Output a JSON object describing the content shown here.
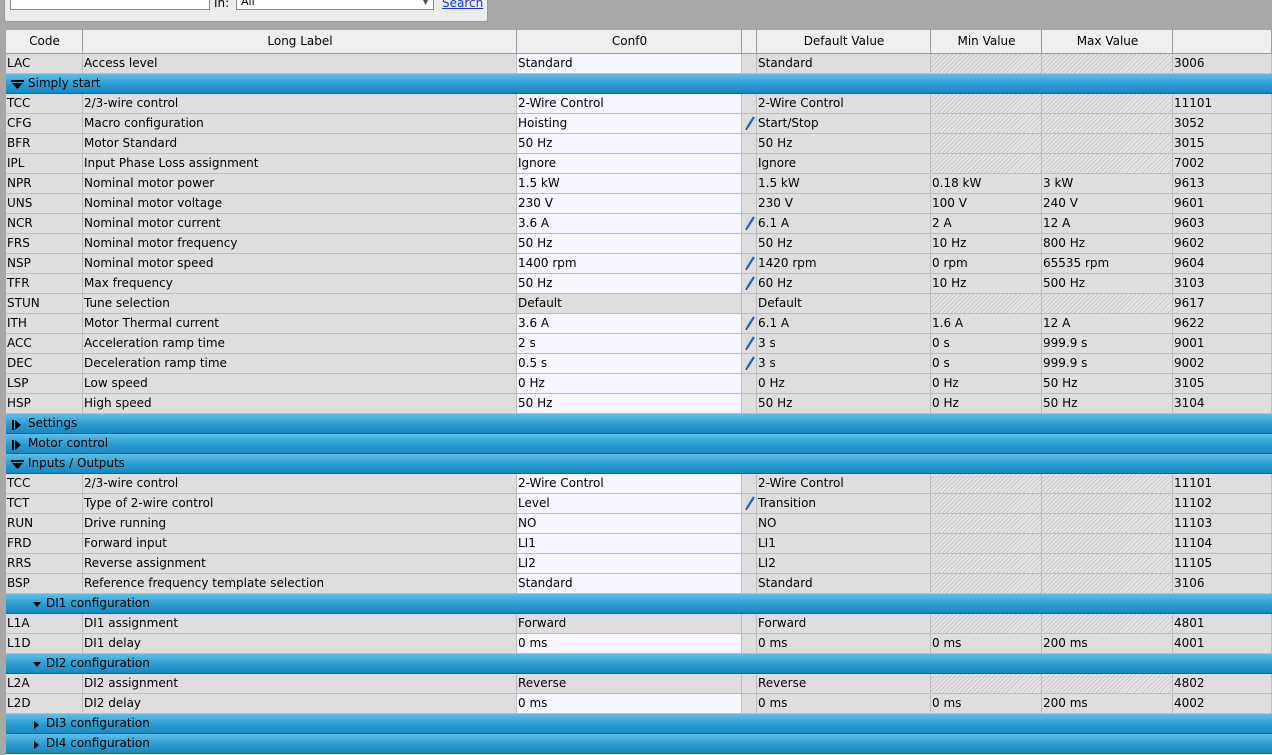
{
  "toolbar": {
    "search_value": "",
    "in_label": "In:",
    "in_select": "All",
    "search_link": "Search"
  },
  "columns": {
    "code": "Code",
    "label": "Long Label",
    "conf": "Conf0",
    "edit": "",
    "default": "Default Value",
    "min": "Min Value",
    "max": "Max Value",
    "id": ""
  },
  "rows": [
    {
      "type": "data",
      "code": "LAC",
      "label": "Access level",
      "conf": "Standard",
      "conf_white": true,
      "edited": false,
      "default": "Standard",
      "min": "",
      "max": "",
      "hatch": true,
      "id": "3006"
    },
    {
      "type": "section",
      "level": 0,
      "expanded": true,
      "label": "Simply start"
    },
    {
      "type": "data",
      "code": "TCC",
      "label": "2/3-wire control",
      "conf": "2-Wire Control",
      "conf_white": true,
      "edited": false,
      "default": "2-Wire Control",
      "min": "",
      "max": "",
      "hatch": true,
      "id": "11101"
    },
    {
      "type": "data",
      "code": "CFG",
      "label": "Macro configuration",
      "conf": "Hoisting",
      "conf_white": true,
      "edited": true,
      "default": "Start/Stop",
      "min": "",
      "max": "",
      "hatch": true,
      "id": "3052"
    },
    {
      "type": "data",
      "code": "BFR",
      "label": "Motor Standard",
      "conf": "50 Hz",
      "conf_white": true,
      "edited": false,
      "default": "50 Hz",
      "min": "",
      "max": "",
      "hatch": true,
      "id": "3015"
    },
    {
      "type": "data",
      "code": "IPL",
      "label": "Input Phase Loss assignment",
      "conf": "Ignore",
      "conf_white": true,
      "edited": false,
      "default": "Ignore",
      "min": "",
      "max": "",
      "hatch": true,
      "id": "7002"
    },
    {
      "type": "data",
      "code": "NPR",
      "label": "Nominal motor power",
      "conf": "1.5 kW",
      "conf_white": true,
      "edited": false,
      "default": "1.5 kW",
      "min": "0.18 kW",
      "max": "3 kW",
      "hatch": false,
      "id": "9613"
    },
    {
      "type": "data",
      "code": "UNS",
      "label": "Nominal motor voltage",
      "conf": "230 V",
      "conf_white": true,
      "edited": false,
      "default": "230 V",
      "min": "100 V",
      "max": "240 V",
      "hatch": false,
      "id": "9601"
    },
    {
      "type": "data",
      "code": "NCR",
      "label": "Nominal motor current",
      "conf": "3.6 A",
      "conf_white": true,
      "edited": true,
      "default": "6.1 A",
      "min": "2 A",
      "max": "12 A",
      "hatch": false,
      "id": "9603"
    },
    {
      "type": "data",
      "code": "FRS",
      "label": "Nominal motor frequency",
      "conf": "50 Hz",
      "conf_white": true,
      "edited": false,
      "default": "50 Hz",
      "min": "10 Hz",
      "max": "800 Hz",
      "hatch": false,
      "id": "9602"
    },
    {
      "type": "data",
      "code": "NSP",
      "label": "Nominal motor speed",
      "conf": "1400 rpm",
      "conf_white": true,
      "edited": true,
      "default": "1420 rpm",
      "min": "0 rpm",
      "max": "65535 rpm",
      "hatch": false,
      "id": "9604"
    },
    {
      "type": "data",
      "code": "TFR",
      "label": "Max frequency",
      "conf": "50 Hz",
      "conf_white": true,
      "edited": true,
      "default": "60 Hz",
      "min": "10 Hz",
      "max": "500 Hz",
      "hatch": false,
      "id": "3103"
    },
    {
      "type": "data",
      "code": "STUN",
      "label": "Tune selection",
      "conf": "Default",
      "conf_white": false,
      "edited": false,
      "default": "Default",
      "min": "",
      "max": "",
      "hatch": true,
      "id": "9617"
    },
    {
      "type": "data",
      "code": "ITH",
      "label": "Motor Thermal current",
      "conf": "3.6 A",
      "conf_white": true,
      "edited": true,
      "default": "6.1 A",
      "min": "1.6 A",
      "max": "12 A",
      "hatch": false,
      "id": "9622"
    },
    {
      "type": "data",
      "code": "ACC",
      "label": "Acceleration ramp time",
      "conf": "2 s",
      "conf_white": true,
      "edited": true,
      "default": "3 s",
      "min": "0 s",
      "max": "999.9 s",
      "hatch": false,
      "id": "9001"
    },
    {
      "type": "data",
      "code": "DEC",
      "label": "Deceleration ramp time",
      "conf": "0.5 s",
      "conf_white": true,
      "edited": true,
      "default": "3 s",
      "min": "0 s",
      "max": "999.9 s",
      "hatch": false,
      "id": "9002"
    },
    {
      "type": "data",
      "code": "LSP",
      "label": "Low speed",
      "conf": "0 Hz",
      "conf_white": true,
      "edited": false,
      "default": "0 Hz",
      "min": "0 Hz",
      "max": "50 Hz",
      "hatch": false,
      "id": "3105"
    },
    {
      "type": "data",
      "code": "HSP",
      "label": "High speed",
      "conf": "50 Hz",
      "conf_white": true,
      "edited": false,
      "default": "50 Hz",
      "min": "0 Hz",
      "max": "50 Hz",
      "hatch": false,
      "id": "3104"
    },
    {
      "type": "section",
      "level": 0,
      "expanded": false,
      "label": "Settings"
    },
    {
      "type": "section",
      "level": 0,
      "expanded": false,
      "label": "Motor control"
    },
    {
      "type": "section",
      "level": 0,
      "expanded": true,
      "label": "Inputs / Outputs"
    },
    {
      "type": "data",
      "code": "TCC",
      "label": "2/3-wire control",
      "conf": "2-Wire Control",
      "conf_white": true,
      "edited": false,
      "default": "2-Wire Control",
      "min": "",
      "max": "",
      "hatch": true,
      "id": "11101"
    },
    {
      "type": "data",
      "code": "TCT",
      "label": "Type of 2-wire control",
      "conf": "Level",
      "conf_white": true,
      "edited": true,
      "default": "Transition",
      "min": "",
      "max": "",
      "hatch": true,
      "id": "11102"
    },
    {
      "type": "data",
      "code": "RUN",
      "label": "Drive running",
      "conf": "NO",
      "conf_white": true,
      "edited": false,
      "default": "NO",
      "min": "",
      "max": "",
      "hatch": true,
      "id": "11103"
    },
    {
      "type": "data",
      "code": "FRD",
      "label": "Forward input",
      "conf": "LI1",
      "conf_white": true,
      "edited": false,
      "default": "LI1",
      "min": "",
      "max": "",
      "hatch": true,
      "id": "11104"
    },
    {
      "type": "data",
      "code": "RRS",
      "label": "Reverse assignment",
      "conf": "LI2",
      "conf_white": true,
      "edited": false,
      "default": "LI2",
      "min": "",
      "max": "",
      "hatch": true,
      "id": "11105"
    },
    {
      "type": "data",
      "code": "BSP",
      "label": "Reference frequency template selection",
      "conf": "Standard",
      "conf_white": true,
      "edited": false,
      "default": "Standard",
      "min": "",
      "max": "",
      "hatch": true,
      "id": "3106"
    },
    {
      "type": "section",
      "level": 1,
      "expanded": true,
      "label": "DI1 configuration"
    },
    {
      "type": "data",
      "code": "L1A",
      "label": "DI1 assignment",
      "conf": "Forward",
      "conf_white": false,
      "edited": false,
      "default": "Forward",
      "min": "",
      "max": "",
      "hatch": true,
      "id": "4801"
    },
    {
      "type": "data",
      "code": "L1D",
      "label": "DI1 delay",
      "conf": "0 ms",
      "conf_white": true,
      "edited": false,
      "default": "0 ms",
      "min": "0 ms",
      "max": "200 ms",
      "hatch": false,
      "id": "4001"
    },
    {
      "type": "section",
      "level": 1,
      "expanded": true,
      "label": "DI2 configuration"
    },
    {
      "type": "data",
      "code": "L2A",
      "label": "DI2 assignment",
      "conf": "Reverse",
      "conf_white": false,
      "edited": false,
      "default": "Reverse",
      "min": "",
      "max": "",
      "hatch": true,
      "id": "4802"
    },
    {
      "type": "data",
      "code": "L2D",
      "label": "DI2 delay",
      "conf": "0 ms",
      "conf_white": true,
      "edited": false,
      "default": "0 ms",
      "min": "0 ms",
      "max": "200 ms",
      "hatch": false,
      "id": "4002"
    },
    {
      "type": "section",
      "level": 1,
      "expanded": false,
      "label": "DI3 configuration"
    },
    {
      "type": "section",
      "level": 1,
      "expanded": false,
      "label": "DI4 configuration"
    }
  ]
}
